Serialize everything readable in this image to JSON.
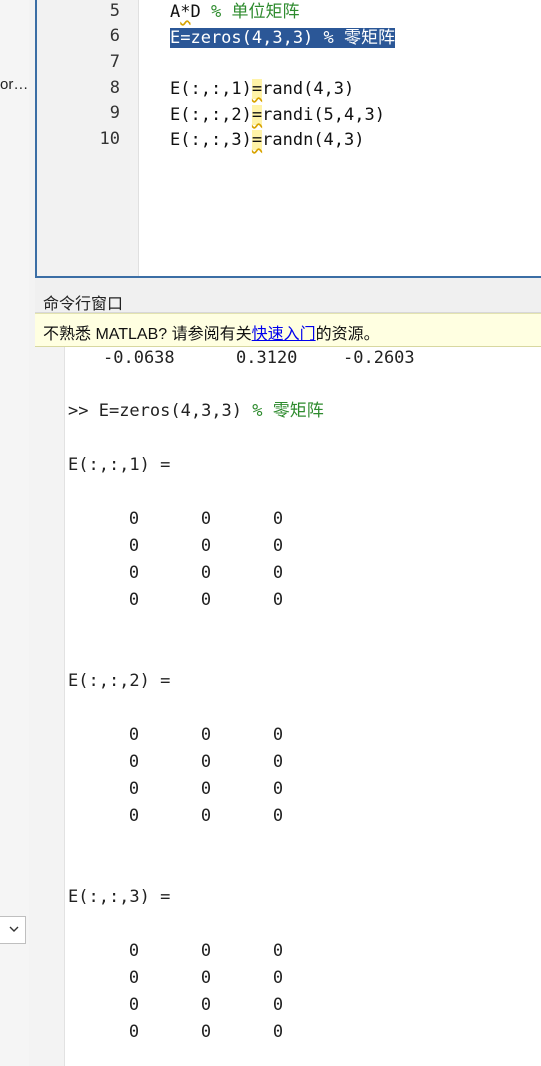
{
  "left_panel": {
    "truncated_label": "or…"
  },
  "editor": {
    "lines": [
      {
        "num": "5"
      },
      {
        "num": "6"
      },
      {
        "num": "7"
      },
      {
        "num": "8"
      },
      {
        "num": "9"
      },
      {
        "num": "10"
      }
    ],
    "line5": {
      "a": "A",
      "star": "*",
      "d": "D",
      "rest": " ",
      "comment": "% 单位矩阵"
    },
    "line6": {
      "code": "E=zeros(4,3,3)",
      "comment": " % 零矩阵"
    },
    "line8": {
      "pre": "E(:,:,1)",
      "eq": "=",
      "post": "rand(4,3)"
    },
    "line9": {
      "pre": "E(:,:,2)",
      "eq": "=",
      "post": "randi(5,4,3)"
    },
    "line10": {
      "pre": "E(:,:,3)",
      "eq": "=",
      "post": "randn(4,3)"
    }
  },
  "command_window": {
    "title": "命令行窗口",
    "banner": {
      "prefix": "不熟悉 MATLAB? 请参阅有关",
      "link": "快速入门",
      "suffix": "的资源。"
    },
    "prev_row": [
      "-0.0638",
      "0.3120",
      "-0.2603"
    ],
    "prompt": ">> ",
    "command": "E=zeros(4,3,3) ",
    "command_comment": "% 零矩阵",
    "slice_labels": [
      "E(:,:,1) =",
      "E(:,:,2) =",
      "E(:,:,3) ="
    ],
    "zero": "0"
  }
}
